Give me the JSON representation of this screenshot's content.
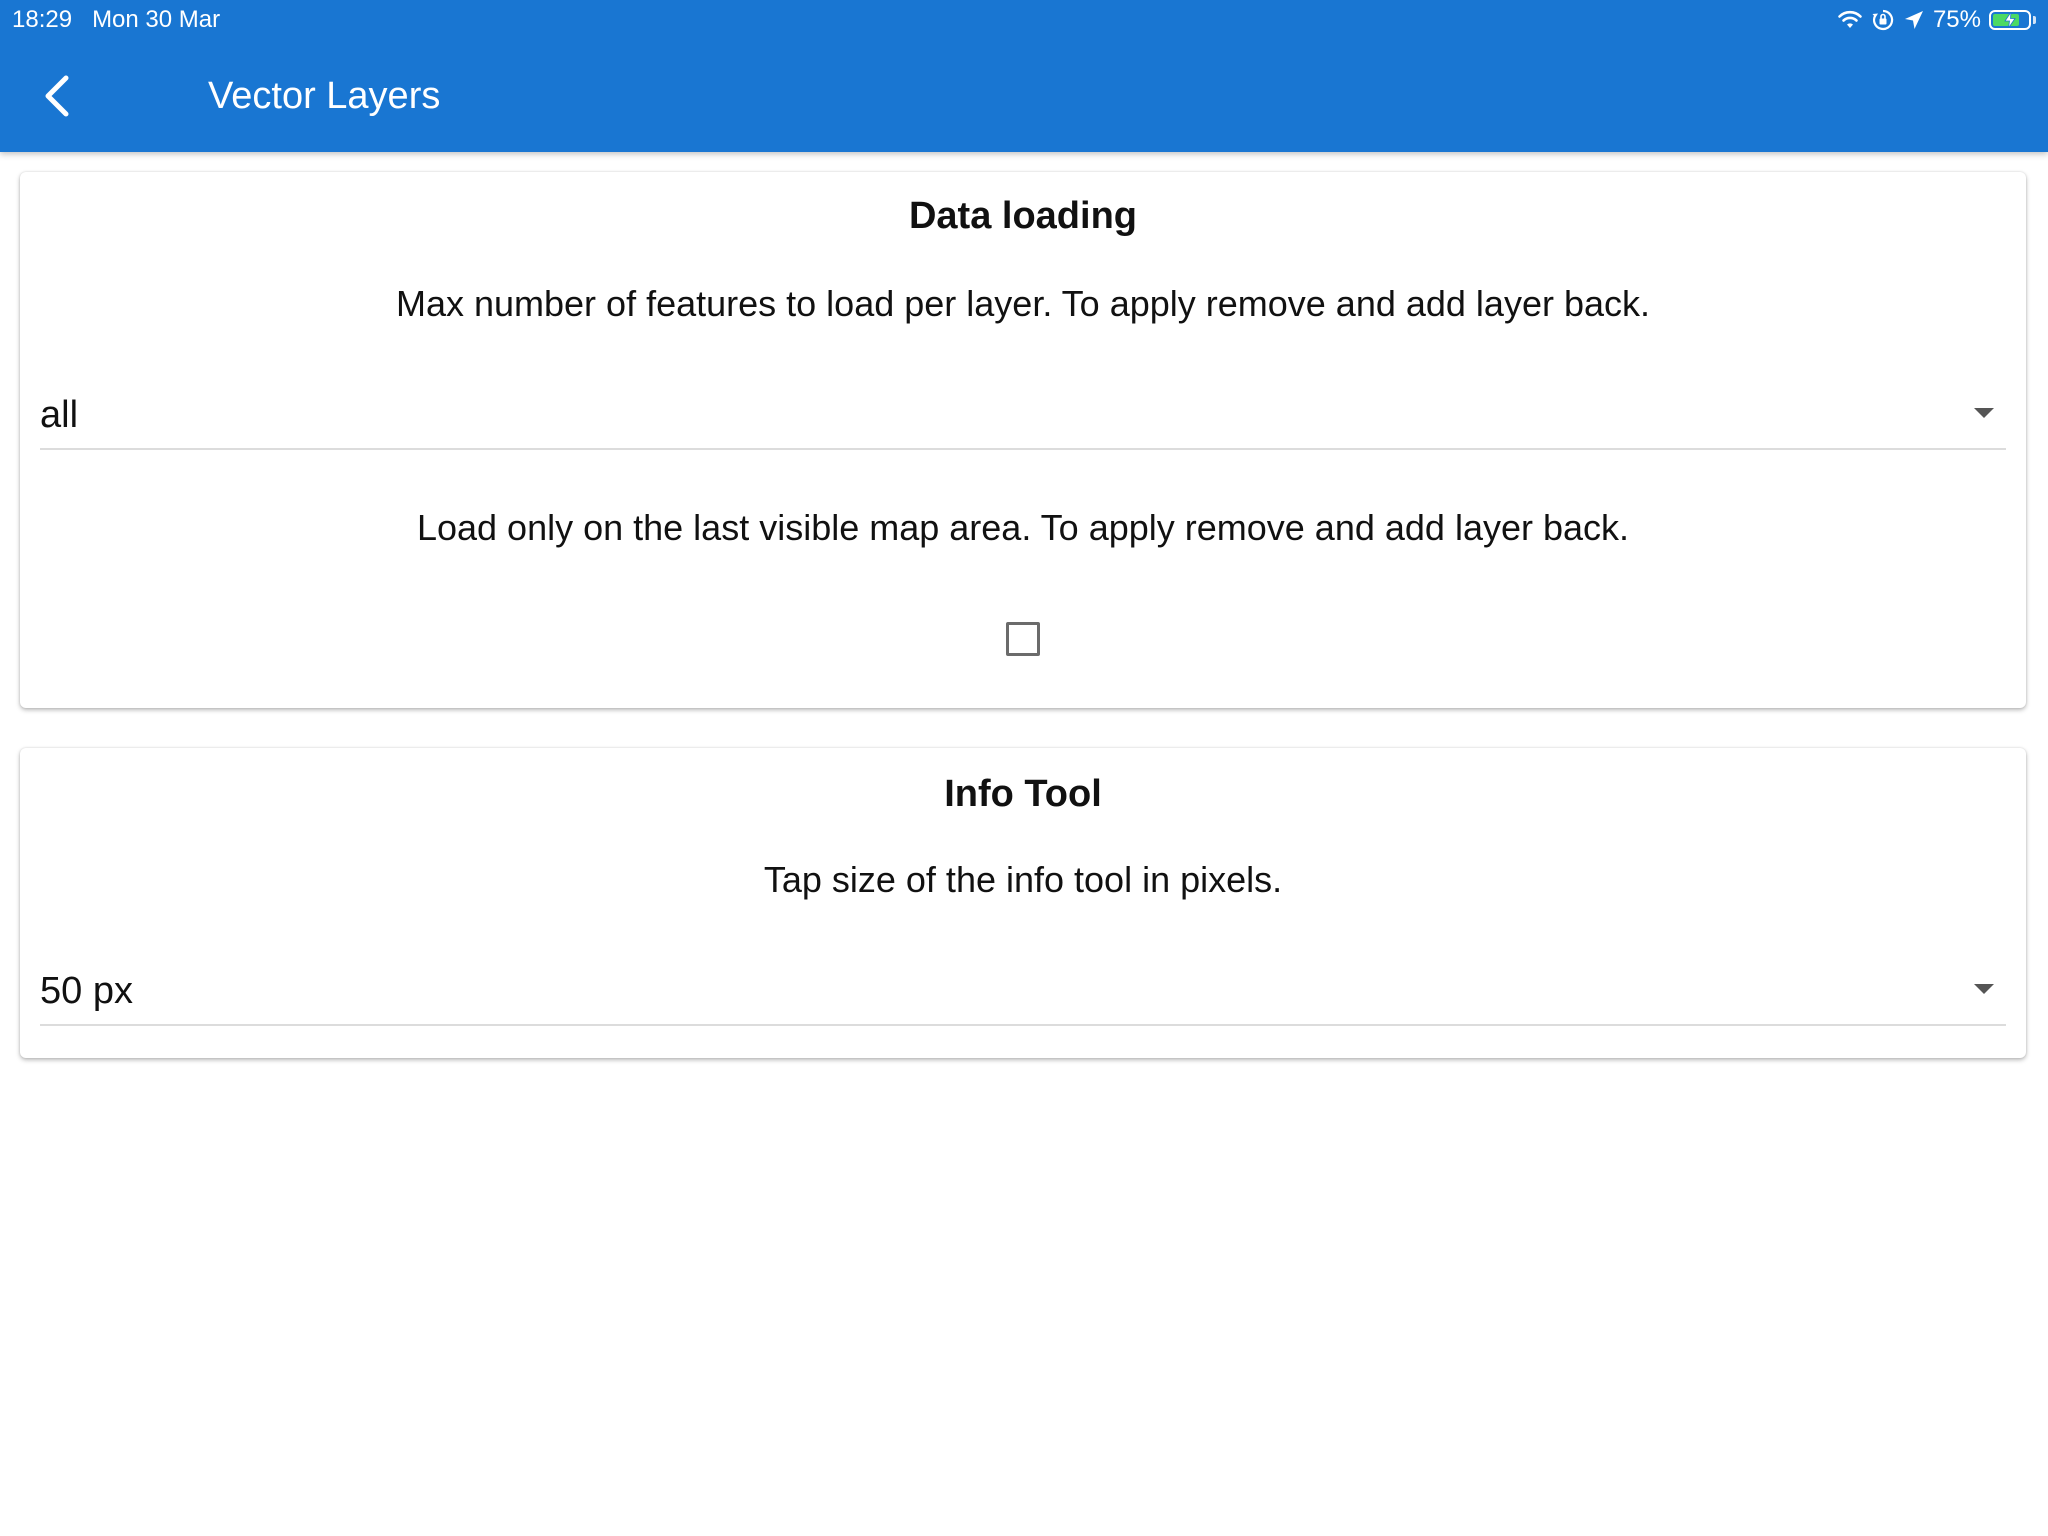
{
  "status_bar": {
    "time": "18:29",
    "date": "Mon 30 Mar",
    "battery_percent": "75%",
    "battery_level": 0.75,
    "icons": [
      "wifi-icon",
      "orientation-lock-icon",
      "location-arrow-icon",
      "battery-charging-icon"
    ]
  },
  "header": {
    "title": "Vector Layers",
    "back_icon": "chevron-left-icon"
  },
  "colors": {
    "app_bar": "#1976d2",
    "battery_fill": "#4cd964"
  },
  "sections": {
    "data_loading": {
      "title": "Data loading",
      "max_features_description": "Max number of features to load per layer. To apply remove and add layer back.",
      "max_features_value": "all",
      "visible_area_description": "Load only on the last visible map area. To apply remove and add layer back.",
      "visible_area_checked": false
    },
    "info_tool": {
      "title": "Info Tool",
      "tap_size_description": "Tap size of the info tool in pixels.",
      "tap_size_value": "50 px"
    }
  }
}
